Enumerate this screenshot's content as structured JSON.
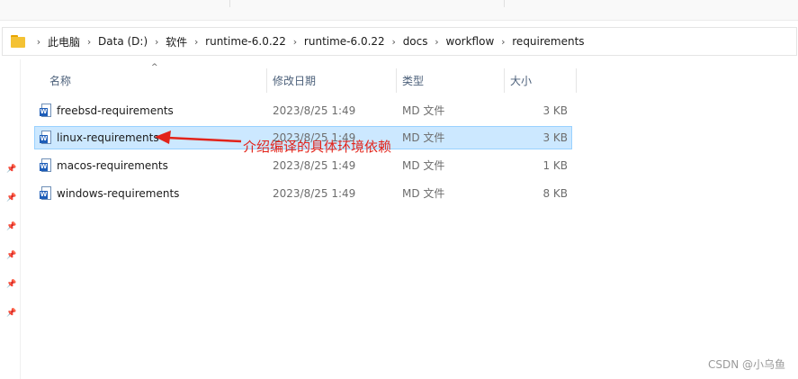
{
  "address_bar": {
    "breadcrumbs": [
      "此电脑",
      "Data (D:)",
      "软件",
      "runtime-6.0.22",
      "runtime-6.0.22",
      "docs",
      "workflow",
      "requirements"
    ]
  },
  "file_list": {
    "columns": {
      "name": "名称",
      "date": "修改日期",
      "type": "类型",
      "size": "大小"
    },
    "rows": [
      {
        "name": "freebsd-requirements",
        "date": "2023/8/25 1:49",
        "type": "MD 文件",
        "size": "3 KB",
        "selected": false
      },
      {
        "name": "linux-requirements",
        "date": "2023/8/25 1:49",
        "type": "MD 文件",
        "size": "3 KB",
        "selected": true
      },
      {
        "name": "macos-requirements",
        "date": "2023/8/25 1:49",
        "type": "MD 文件",
        "size": "1 KB",
        "selected": false
      },
      {
        "name": "windows-requirements",
        "date": "2023/8/25 1:49",
        "type": "MD 文件",
        "size": "8 KB",
        "selected": false
      }
    ]
  },
  "annotation": {
    "text": "介绍编译的具体环境依赖",
    "color": "#e2231a"
  },
  "watermark": "CSDN @小乌鱼",
  "colors": {
    "selection_bg": "#cce8ff",
    "selection_border": "#99d1ff",
    "header_text": "#4c607a",
    "folder": "#f4c234"
  },
  "icons": {
    "address_bar": "folder-icon",
    "breadcrumb_separator": "chevron-right-icon",
    "file": "markdown-document-icon",
    "nav_pane": "pin-icon"
  }
}
